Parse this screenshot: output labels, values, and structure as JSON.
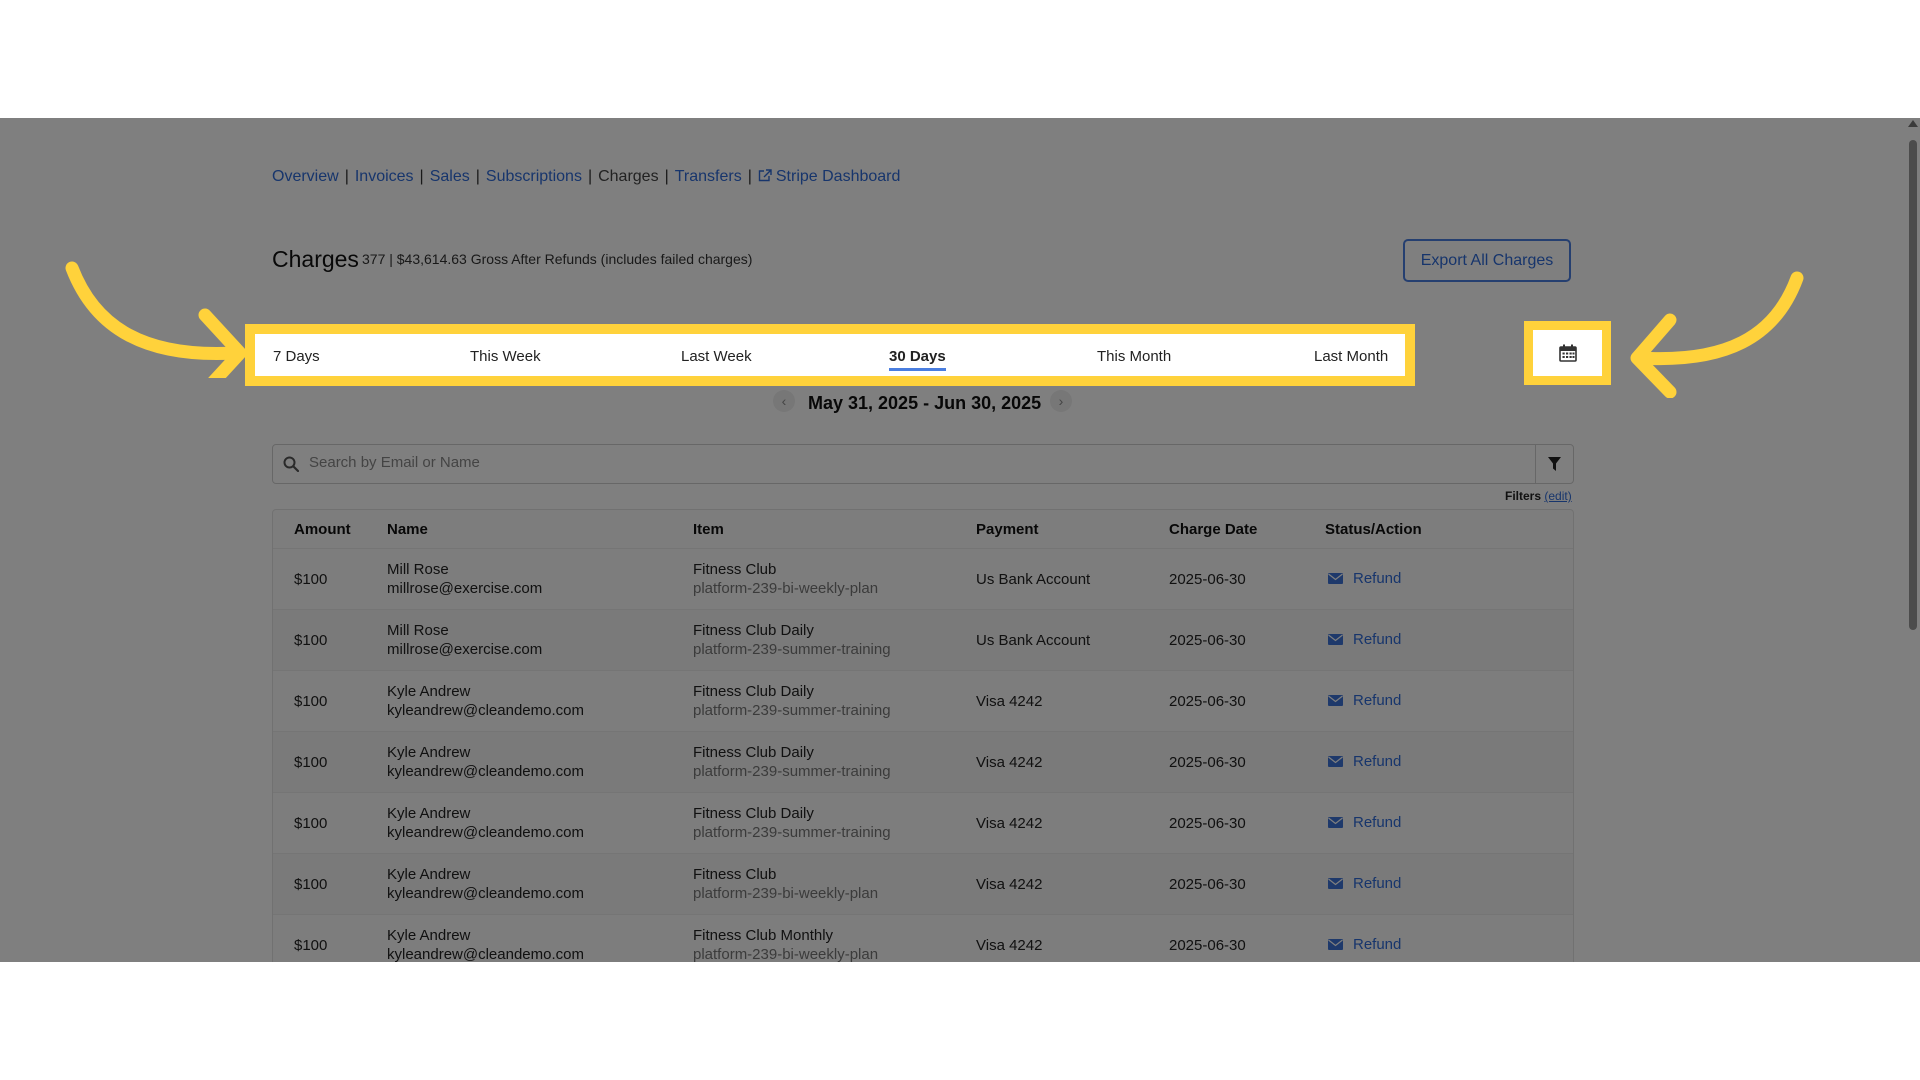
{
  "nav": {
    "items": [
      "Overview",
      "Invoices",
      "Sales",
      "Subscriptions",
      "Charges",
      "Transfers",
      "Stripe Dashboard"
    ],
    "active": "Charges"
  },
  "header": {
    "title": "Charges",
    "stats": "377 | $43,614.63 Gross After Refunds (includes failed charges)",
    "export_label": "Export All Charges"
  },
  "range_tabs": [
    "7 Days",
    "This Week",
    "Last Week",
    "30 Days",
    "This Month",
    "Last Month"
  ],
  "range_active": "30 Days",
  "date_nav": {
    "range": "May 31, 2025 - Jun 30, 2025",
    "prev": "‹",
    "next": "›"
  },
  "search": {
    "placeholder": "Search by Email or Name"
  },
  "filters": {
    "label": "Filters",
    "edit": "(edit)"
  },
  "table": {
    "columns": [
      "Amount",
      "Name",
      "Item",
      "Payment",
      "Charge Date",
      "Status/Action"
    ],
    "rows": [
      {
        "amount": "$100",
        "name": "Mill Rose",
        "email": "millrose@exercise.com",
        "item": "Fitness Club",
        "plan": "platform-239-bi-weekly-plan",
        "payment": "Us Bank Account",
        "date": "2025-06-30",
        "action": "Refund"
      },
      {
        "amount": "$100",
        "name": "Mill Rose",
        "email": "millrose@exercise.com",
        "item": "Fitness Club Daily",
        "plan": "platform-239-summer-training",
        "payment": "Us Bank Account",
        "date": "2025-06-30",
        "action": "Refund"
      },
      {
        "amount": "$100",
        "name": "Kyle Andrew",
        "email": "kyleandrew@cleandemo.com",
        "item": "Fitness Club Daily",
        "plan": "platform-239-summer-training",
        "payment": "Visa 4242",
        "date": "2025-06-30",
        "action": "Refund"
      },
      {
        "amount": "$100",
        "name": "Kyle Andrew",
        "email": "kyleandrew@cleandemo.com",
        "item": "Fitness Club Daily",
        "plan": "platform-239-summer-training",
        "payment": "Visa 4242",
        "date": "2025-06-30",
        "action": "Refund"
      },
      {
        "amount": "$100",
        "name": "Kyle Andrew",
        "email": "kyleandrew@cleandemo.com",
        "item": "Fitness Club Daily",
        "plan": "platform-239-summer-training",
        "payment": "Visa 4242",
        "date": "2025-06-30",
        "action": "Refund"
      },
      {
        "amount": "$100",
        "name": "Kyle Andrew",
        "email": "kyleandrew@cleandemo.com",
        "item": "Fitness Club",
        "plan": "platform-239-bi-weekly-plan",
        "payment": "Visa 4242",
        "date": "2025-06-30",
        "action": "Refund"
      },
      {
        "amount": "$100",
        "name": "Kyle Andrew",
        "email": "kyleandrew@cleandemo.com",
        "item": "Fitness Club Monthly",
        "plan": "platform-239-bi-weekly-plan",
        "payment": "Visa 4242",
        "date": "2025-06-30",
        "action": "Refund"
      }
    ]
  },
  "icons": {
    "calendar": "calendar-icon",
    "search": "search-icon",
    "filter": "filter-icon",
    "mail": "mail-icon",
    "external": "external-link-icon"
  },
  "colors": {
    "highlight": "#ffd23b",
    "link": "#2f6bd8",
    "overlay": "rgba(0,0,0,0.5)"
  }
}
